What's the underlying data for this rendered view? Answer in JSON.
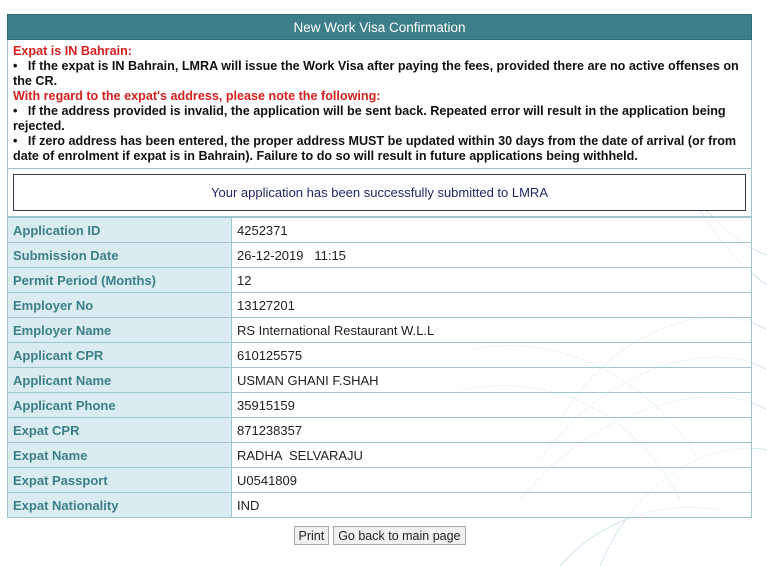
{
  "header": {
    "title": "New Work Visa Confirmation"
  },
  "notes": {
    "heading1": "Expat is IN Bahrain:",
    "bullet1": "If the expat is IN Bahrain, LMRA will issue the Work Visa after paying the fees, provided there are no active offenses on the CR.",
    "heading2": "With regard to the expat's address, please note the following:",
    "bullet2": "If the address provided is invalid, the application will be sent back. Repeated error will result in the application being rejected.",
    "bullet3": "If zero address has been entered, the proper address MUST be updated within 30 days from the date of arrival (or from date of enrolment if expat is in Bahrain). Failure to do so will result in future applications being withheld."
  },
  "success_message": "Your application has been successfully submitted to LMRA",
  "details": [
    {
      "label": "Application ID",
      "value": "4252371"
    },
    {
      "label": "Submission Date",
      "value": "26-12-2019   11:15"
    },
    {
      "label": "Permit Period (Months)",
      "value": "12"
    },
    {
      "label": "Employer No",
      "value": "13127201"
    },
    {
      "label": "Employer Name",
      "value": "RS International Restaurant W.L.L"
    },
    {
      "label": "Applicant CPR",
      "value": "610125575"
    },
    {
      "label": "Applicant Name",
      "value": "USMAN GHANI F.SHAH"
    },
    {
      "label": "Applicant Phone",
      "value": "35915159"
    },
    {
      "label": "Expat CPR",
      "value": "871238357"
    },
    {
      "label": "Expat Name",
      "value": "RADHA  SELVARAJU"
    },
    {
      "label": "Expat Passport",
      "value": "U0541809"
    },
    {
      "label": "Expat Nationality",
      "value": "IND"
    }
  ],
  "buttons": {
    "print": "Print",
    "back": "Go back to main page"
  },
  "colors": {
    "header_bg": "#3d7f89",
    "label_bg": "#d9ecef",
    "label_text": "#3d7f89",
    "alert_red": "#d42020"
  }
}
